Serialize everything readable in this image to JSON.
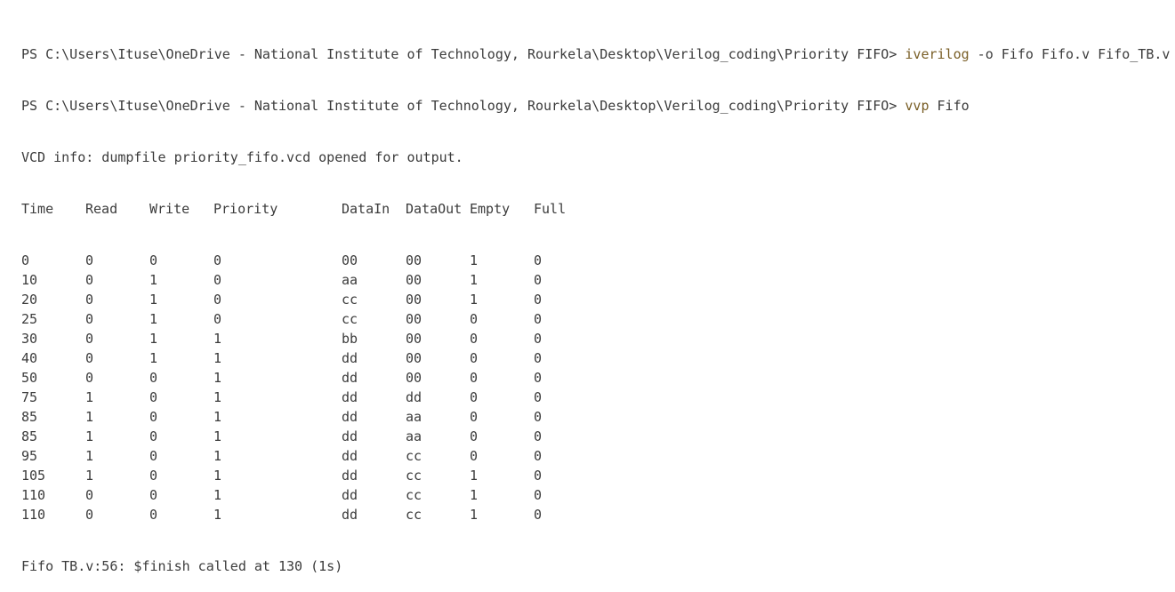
{
  "terminal": {
    "prompt_path": "PS C:\\Users\\Ituse\\OneDrive - National Institute of Technology, Rourkela\\Desktop\\Verilog_coding\\Priority FIFO> ",
    "cmd1": {
      "exe": "iverilog",
      "args": " -o Fifo Fifo.v Fifo_TB.v"
    },
    "cmd2": {
      "exe": "vvp",
      "args": " Fifo"
    },
    "vcd_info": "VCD info: dumpfile priority_fifo.vcd opened for output.",
    "headers": [
      "Time",
      "Read",
      "Write",
      "Priority",
      "DataIn",
      "DataOut",
      "Empty",
      "Full"
    ],
    "rows": [
      [
        "0",
        "0",
        "0",
        "0",
        "00",
        "00",
        "1",
        "0"
      ],
      [
        "10",
        "0",
        "1",
        "0",
        "aa",
        "00",
        "1",
        "0"
      ],
      [
        "20",
        "0",
        "1",
        "0",
        "cc",
        "00",
        "1",
        "0"
      ],
      [
        "25",
        "0",
        "1",
        "0",
        "cc",
        "00",
        "0",
        "0"
      ],
      [
        "30",
        "0",
        "1",
        "1",
        "bb",
        "00",
        "0",
        "0"
      ],
      [
        "40",
        "0",
        "1",
        "1",
        "dd",
        "00",
        "0",
        "0"
      ],
      [
        "50",
        "0",
        "0",
        "1",
        "dd",
        "00",
        "0",
        "0"
      ],
      [
        "75",
        "1",
        "0",
        "1",
        "dd",
        "dd",
        "0",
        "0"
      ],
      [
        "85",
        "1",
        "0",
        "1",
        "dd",
        "aa",
        "0",
        "0"
      ],
      [
        "85",
        "1",
        "0",
        "1",
        "dd",
        "aa",
        "0",
        "0"
      ],
      [
        "95",
        "1",
        "0",
        "1",
        "dd",
        "cc",
        "0",
        "0"
      ],
      [
        "105",
        "1",
        "0",
        "1",
        "dd",
        "cc",
        "1",
        "0"
      ],
      [
        "110",
        "0",
        "0",
        "1",
        "dd",
        "cc",
        "1",
        "0"
      ],
      [
        "110",
        "0",
        "0",
        "1",
        "dd",
        "cc",
        "1",
        "0"
      ]
    ],
    "finish_line": "Fifo TB.v:56: $finish called at 130 (1s)"
  },
  "colors": {
    "text": "#3b3b3b",
    "command": "#795e26",
    "background": "#ffffff"
  }
}
